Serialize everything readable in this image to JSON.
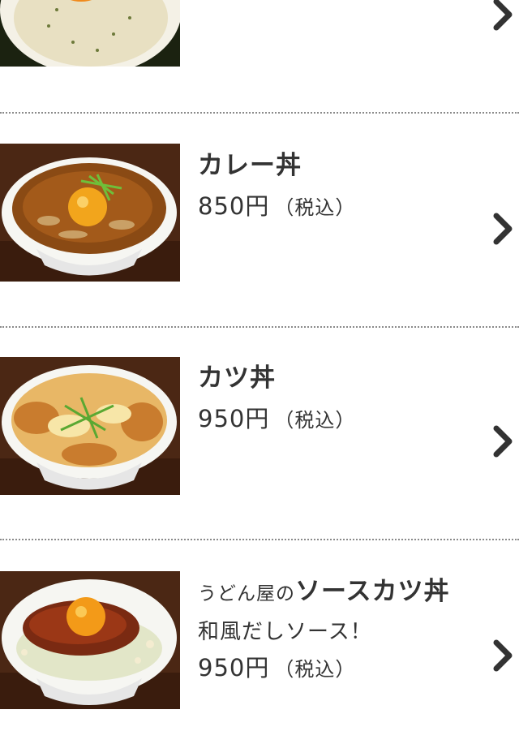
{
  "items": [
    {
      "name": "",
      "price": "",
      "tax": ""
    },
    {
      "name": "カレー丼",
      "price": "850円",
      "tax": "（税込）"
    },
    {
      "name": "カツ丼",
      "price": "950円",
      "tax": "（税込）"
    },
    {
      "name_prefix": "うどん屋の",
      "name": "ソースカツ丼",
      "subtitle": "和風だしソース！",
      "price": "950円",
      "tax": "（税込）"
    }
  ],
  "icons": {
    "chevron": "chevron-right-icon"
  },
  "colors": {
    "text": "#333333",
    "divider": "#8a8a8a",
    "chevron": "#333333"
  }
}
